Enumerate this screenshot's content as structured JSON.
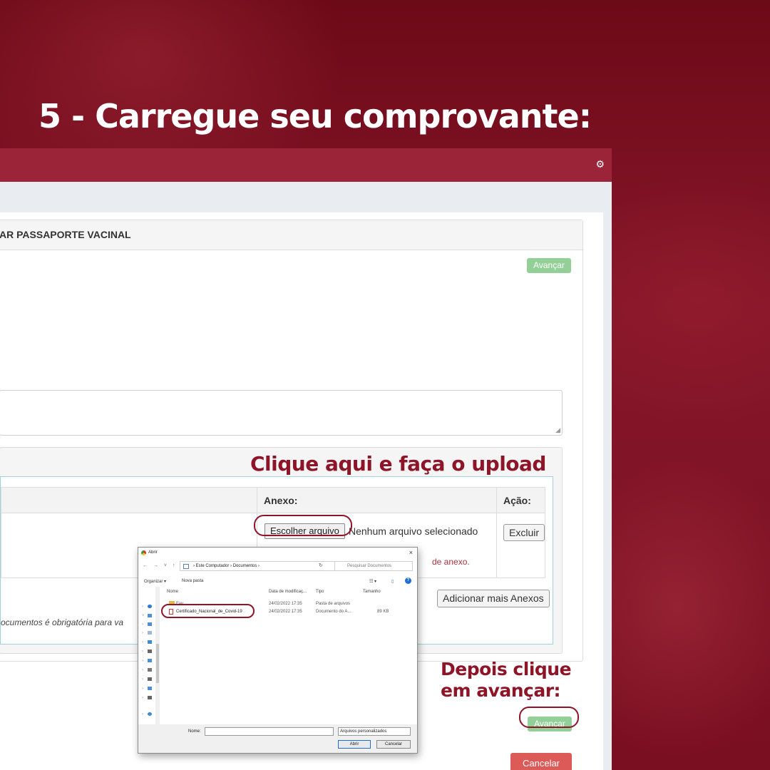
{
  "headline": "5 - Carregue seu comprovante:",
  "app": {
    "section_title": "AR PASSAPORTE VACINAL",
    "avancar_top": "Avançar",
    "avancar_bottom": "Avançar",
    "cancel": "Cancelar",
    "attachments": {
      "col_anexo": "Anexo:",
      "col_acao": "Ação:",
      "choose_file": "Escolher arquivo",
      "no_file": "Nenhum arquivo selecionado",
      "delete": "Excluir",
      "hint": "de anexo.",
      "add_more": "Adicionar mais Anexos",
      "required_note": "ocumentos é obrigatória para va"
    }
  },
  "annotations": {
    "upload": "Clique aqui e faça o upload",
    "next_line1": "Depois clique",
    "next_line2": "em avançar:"
  },
  "dialog": {
    "title": "Abrir",
    "close": "×",
    "nav": "← → ˅ ↑",
    "breadcrumb": "› Este Computador › Documentos ›",
    "refresh": "↻",
    "search_placeholder": "Pesquisar Documentos",
    "toolbar": {
      "organize": "Organizar ▾",
      "new_folder": "Nova pasta",
      "view": "☷ ▾",
      "pane": "▯",
      "help": "?"
    },
    "columns": {
      "name": "Nome",
      "modified": "Data de modificaç...",
      "type": "Tipo",
      "size": "Tamanho"
    },
    "rows": [
      {
        "name": "Fav",
        "modified": "24/02/2022 17:35",
        "type": "Pasta de arquivos",
        "size": ""
      },
      {
        "name": "Certificado_Nacional_de_Covid-19",
        "modified": "24/02/2022 17:35",
        "type": "Documento do A...",
        "size": "89 KB"
      }
    ],
    "name_label": "Nome:",
    "filter": "Arquivos personalizados",
    "open": "Abrir",
    "cancel": "Cancelar"
  },
  "colors": {
    "brand_red": "#9b2438",
    "annotation": "#8e1428",
    "success": "#92d098",
    "danger": "#dc5a58"
  }
}
